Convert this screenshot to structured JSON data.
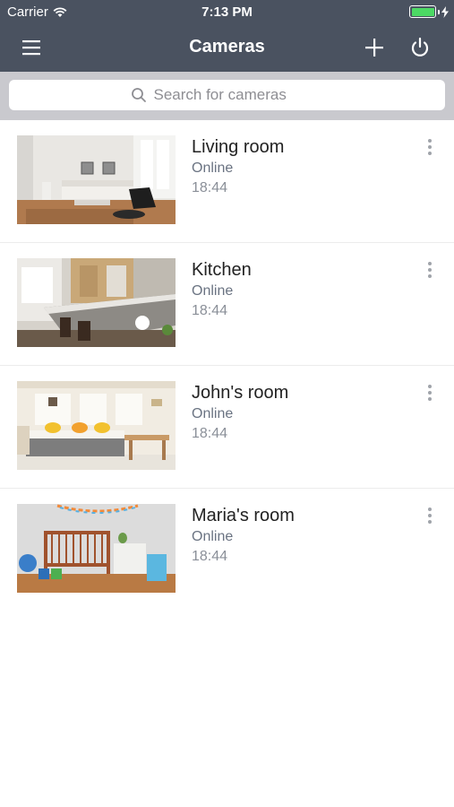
{
  "status_bar": {
    "carrier": "Carrier",
    "time": "7:13 PM",
    "battery_color": "#4cd964",
    "icons": [
      "wifi-icon",
      "battery-icon",
      "charging-icon"
    ]
  },
  "nav": {
    "title": "Cameras",
    "background": "#4a5260",
    "icons": [
      "menu-icon",
      "plus-icon",
      "power-icon"
    ]
  },
  "search": {
    "placeholder": "Search for cameras",
    "value": "",
    "icon": "search-icon"
  },
  "cameras": [
    {
      "name": "Living room",
      "status": "Online",
      "time": "18:44",
      "thumbnail": "living-room-image"
    },
    {
      "name": "Kitchen",
      "status": "Online",
      "time": "18:44",
      "thumbnail": "kitchen-image"
    },
    {
      "name": "John's room",
      "status": "Online",
      "time": "18:44",
      "thumbnail": "johns-room-image"
    },
    {
      "name": "Maria's room",
      "status": "Online",
      "time": "18:44",
      "thumbnail": "marias-room-image"
    }
  ]
}
